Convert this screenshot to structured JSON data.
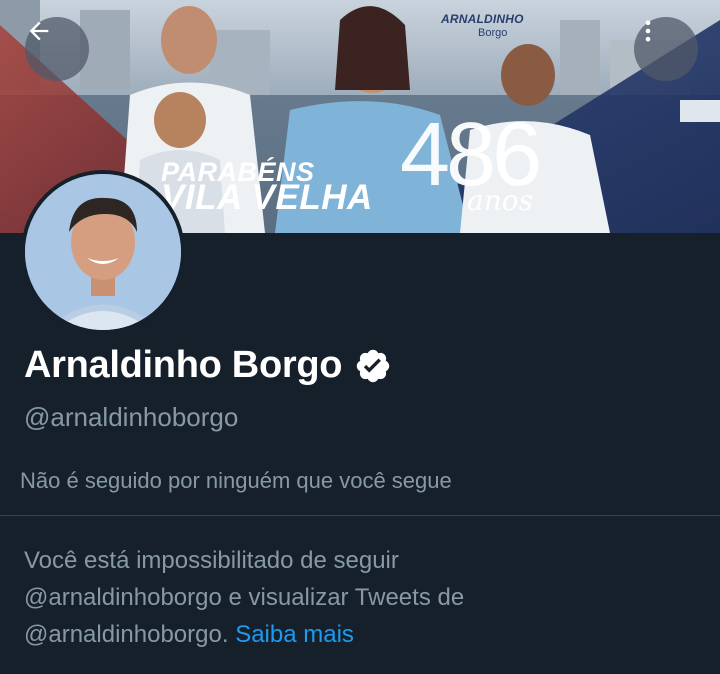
{
  "header": {
    "back_icon": "arrow-left-icon",
    "more_icon": "more-vertical-icon",
    "banner": {
      "brand_name": "ARNALDINHO",
      "brand_sub": "Borgo",
      "line1": "PARABÉNS",
      "line2": "VILA VELHA",
      "number": "486",
      "number_suffix": "anos"
    }
  },
  "profile": {
    "name": "Arnaldinho Borgo",
    "verified_icon": "verified-badge-icon",
    "handle": "@arnaldinhoborgo",
    "followed_by": "Não é seguido por ninguém que você segue"
  },
  "blocked_notice": {
    "line1": "Você está impossibilitado de seguir",
    "line2": "@arnaldinhoborgo e visualizar Tweets de",
    "line3": "@arnaldinhoborgo.",
    "link": "Saiba mais"
  },
  "colors": {
    "background": "#15202b",
    "text_secondary": "#8899a6",
    "link": "#1d9bf0",
    "divider": "#38444d"
  }
}
